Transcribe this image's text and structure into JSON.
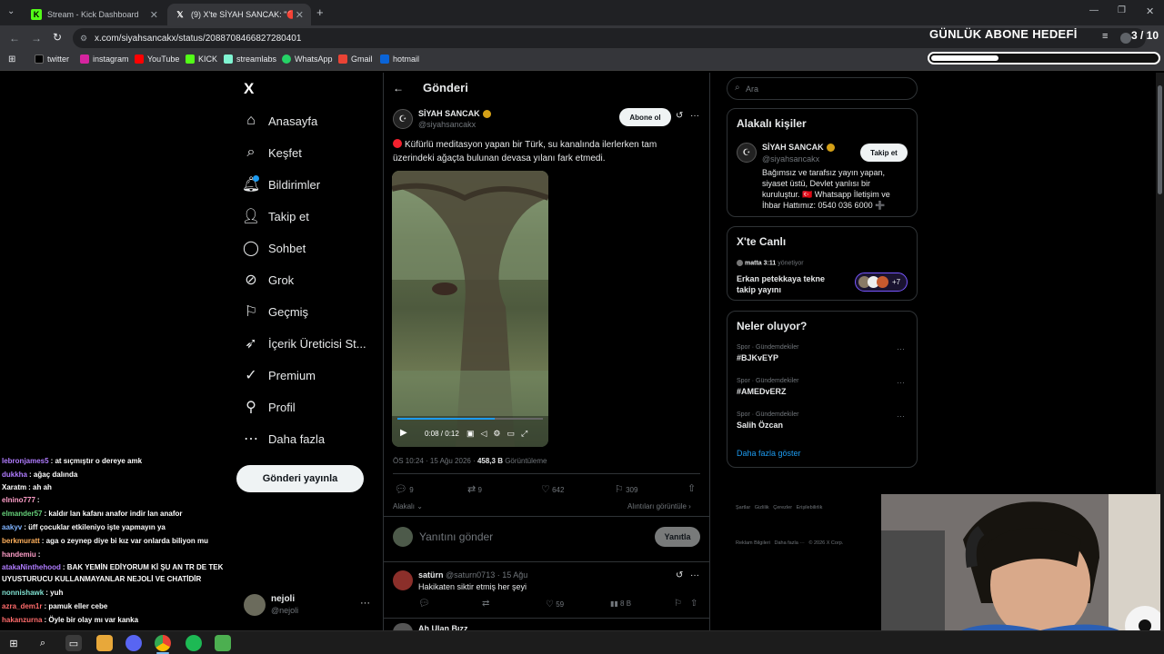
{
  "browser": {
    "tabs": [
      {
        "label": "Stream - Kick Dashboard",
        "active": false
      },
      {
        "label": "(9) X'te SİYAH SANCAK: \"🔴 Kü",
        "active": true
      }
    ],
    "new_tab": "+",
    "url": "x.com/siyahsancakx/status/2088708466827280401",
    "bookmarks": [
      "twitter",
      "instagram",
      "YouTube",
      "KICK",
      "streamlabs",
      "WhatsApp",
      "Gmail",
      "hotmail"
    ]
  },
  "overlay": {
    "goal_title": "GÜNLÜK ABONE HEDEFİ",
    "goal_count": "3 / 10",
    "goal_progress": 0.3
  },
  "nav": {
    "logo": "X",
    "items": [
      {
        "label": "Anasayfa",
        "icon": "home-icon"
      },
      {
        "label": "Keşfet",
        "icon": "search-icon"
      },
      {
        "label": "Bildirimler",
        "icon": "bell-icon"
      },
      {
        "label": "Takip et",
        "icon": "follow-icon"
      },
      {
        "label": "Sohbet",
        "icon": "chat-icon"
      },
      {
        "label": "Grok",
        "icon": "grok-icon"
      },
      {
        "label": "Geçmiş",
        "icon": "bookmark-icon"
      },
      {
        "label": "İçerik Üreticisi St...",
        "icon": "rocket-icon"
      },
      {
        "label": "Premium",
        "icon": "premium-icon"
      },
      {
        "label": "Profil",
        "icon": "person-icon"
      },
      {
        "label": "Daha fazla",
        "icon": "more-icon"
      }
    ],
    "post_button": "Gönderi yayınla",
    "account_name": "nejoli",
    "account_handle": "@nejoli",
    "account_more": "···"
  },
  "chat": [
    {
      "user": "lebronjames5",
      "text": ": at sıçmıştır o dereye amk",
      "color": "#b07cff"
    },
    {
      "user": "dukkha",
      "text": ": ağaç dalında",
      "color": "#b07cff"
    },
    {
      "user": "Xaratm",
      "text": ": ah ah",
      "color": "#ffffff"
    },
    {
      "user": "elnino777",
      "text": ":",
      "color": "#ff9ec8"
    },
    {
      "user": "elmander57",
      "text": ": kaldır lan kafanı anafor indir lan anafor",
      "color": "#66d17a"
    },
    {
      "user": "aakyv",
      "text": ": üff çocuklar etkileniyo işte yapmayın ya",
      "color": "#7fb3ff"
    },
    {
      "user": "berkmuratt",
      "text": ": aga o zeynep diye bi kız var onlarda biliyon mu",
      "color": "#ffb05c"
    },
    {
      "user": "handemiu",
      "text": ":",
      "color": "#ff9ec8"
    },
    {
      "user": "atakaNinthehood",
      "text": ": BAK YEMİN EDİYORUM Kİ ŞU AN TR DE TEK",
      "color": "#b07cff"
    },
    {
      "user": "",
      "text": "UYUSTURUCU KULLANMAYANLAR NEJOLİ VE CHATİDİR",
      "color": "#ffffff"
    },
    {
      "user": "nonnishawk",
      "text": ": yuh",
      "color": "#7fe0d0"
    },
    {
      "user": "azra_dem1r",
      "text": ": pamuk eller cebe",
      "color": "#ff6b6b"
    },
    {
      "user": "hakanzurna",
      "text": ": Öyle bir olay mı var kanka",
      "color": "#ff6b6b"
    }
  ],
  "main": {
    "header_title": "Gönderi",
    "author_name": "SİYAH SANCAK",
    "author_handle": "@siyahsancakx",
    "subscribe_label": "Abone ol",
    "more": "···",
    "tweet_text": "Küfürlü meditasyon yapan bir Türk, su kanalında ilerlerken tam üzerindeki ağaçta bulunan devasa yılanı fark etmedi.",
    "video_time": "0:08 / 0:12",
    "video_progress": 0.667,
    "timestamp": "ÖS 10:24 · 15 Ağu 2026 · ",
    "views_count": "458,3 B",
    "views_label": " Görüntüleme",
    "actions": {
      "replies": "9",
      "reposts": "9",
      "likes": "642",
      "bookmarks": "309"
    },
    "related_label": "Alakalı",
    "quotes_label": "Alıntıları görüntüle",
    "reply_placeholder": "Yanıtını gönder",
    "reply_button": "Yanıtla",
    "reply": {
      "name": "satürn",
      "handle": "@saturn0713 · 15 Ağu",
      "text": "Hakikaten siktir etmiş her şeyi",
      "likes": "59",
      "views": "8 B"
    },
    "next_reply_name": "Ah Ulan Bızz"
  },
  "right": {
    "search_placeholder": "Ara",
    "related_title": "Alakalı kişiler",
    "related_name": "SİYAH SANCAK",
    "related_handle": "@siyahsancakx",
    "follow_label": "Takip et",
    "related_bio": "Bağımsız ve tarafsız yayın yapan, siyaset üstü, Devlet yanlısı bir kuruluştur. 🇹🇷 Whatsapp İletişim ve İhbar Hattımız: 0540 036 6000 ➕",
    "live_title": "X'te Canlı",
    "live_host": "matta 3:11",
    "live_host_role": "yönetiyor",
    "live_text": "Erkan petekkaya tekne takip yayını",
    "live_count": "+7",
    "trends_title": "Neler oluyor?",
    "trends": [
      {
        "meta": "Spor · Gündemdekiler",
        "name": "#BJKvEYP"
      },
      {
        "meta": "Spor · Gündemdekiler",
        "name": "#AMEDvERZ"
      },
      {
        "meta": "Spor · Gündemdekiler",
        "name": "Salih Özcan"
      }
    ],
    "show_more": "Daha fazla göster",
    "footer_line1": "Şartlar   Gizlilik   Çerezler   Erişilebilirlik",
    "footer_line2": "Reklam Bilgileri   Daha fazla ···   © 2026 X Corp."
  },
  "colors": {
    "accent": "#1d9bf0",
    "live_red": "#f4212e",
    "kick_green": "#53fc18"
  }
}
